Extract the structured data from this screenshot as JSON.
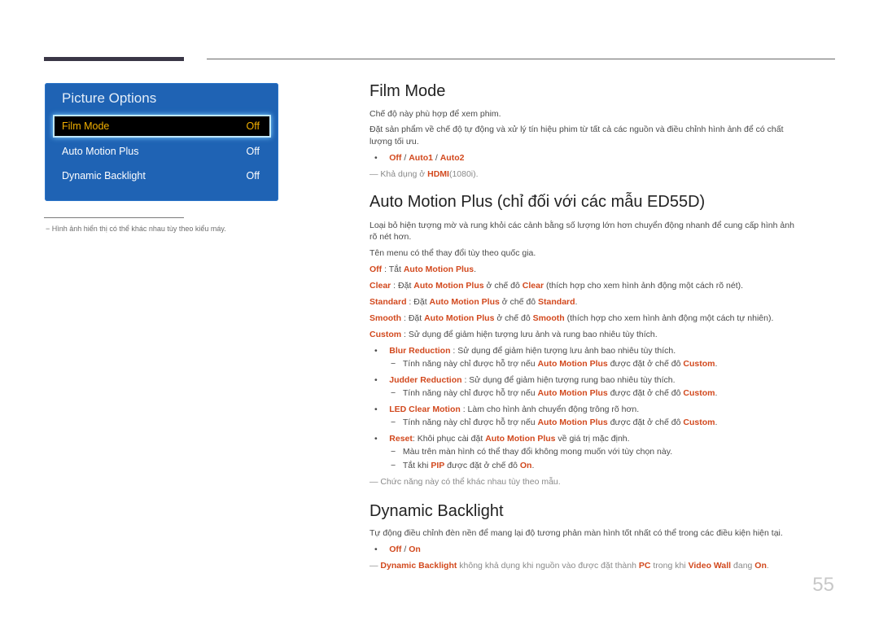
{
  "menu": {
    "title": "Picture Options",
    "items": [
      {
        "label": "Film Mode",
        "value": "Off",
        "selected": true
      },
      {
        "label": "Auto Motion Plus",
        "value": "Off"
      },
      {
        "label": "Dynamic Backlight",
        "value": "Off"
      }
    ],
    "note": "Hình ảnh hiển thị có thể khác nhau tùy theo kiểu máy."
  },
  "film_mode": {
    "title": "Film Mode",
    "p1": "Chế độ này phù hợp để xem phim.",
    "p2a": "Đặt sản phẩm về chế độ tự động và xử lý tín hiệu phim từ tất cả các nguồn và điều chỉnh hình ảnh để có chất",
    "p2b": "lượng tối ưu.",
    "opt_off": "Off",
    "opt_auto1": "Auto1",
    "opt_auto2": "Auto2",
    "sep": " / ",
    "note_pre": "Khả dụng ở ",
    "note_hl": "HDMI",
    "note_post": "(1080i)."
  },
  "amp": {
    "title": "Auto Motion Plus (chỉ đối với các mẫu ED55D)",
    "p1a": "Loại bỏ hiện tượng mờ và rung khỏi các cảnh bằng số lượng lớn hơn chuyển động nhanh để cung cấp hình ảnh",
    "p1b": "rõ nét hơn.",
    "p2": "Tên menu có thể thay đổi tùy theo quốc gia.",
    "amp": "Auto Motion Plus",
    "off": "Off",
    "off_text": " : Tắt ",
    "clear": "Clear",
    "set_text": " : Đặt ",
    "mode_text": " ở chế đô ",
    "clear_tail": " (thích hợp cho xem hình ảnh động một cách rõ nét).",
    "standard": "Standard",
    "smooth": "Smooth",
    "smooth_tail": " (thích hợp cho xem hình ảnh động một cách tự nhiên).",
    "custom": "Custom",
    "custom_text": " : Sử dụng để giảm hiện tượng lưu ảnh và rung bao nhiêu tùy thích.",
    "blur": "Blur Reduction",
    "blur_text": " : Sử dụng để giảm hiện tượng lưu ảnh bao nhiêu tùy thích.",
    "supported_pre": "Tính năng này chỉ được hỗ trợ nếu ",
    "supported_mid": " được đặt ở chế đô ",
    "judder": "Judder Reduction",
    "judder_text": " : Sử dụng để giảm hiện tượng rung bao nhiêu tùy thích.",
    "led": "LED Clear Motion",
    "led_text": " : Làm cho hình ảnh chuyển động trông rõ hơn.",
    "reset": "Reset",
    "reset_pre": ": Khôi phục cài đặt ",
    "reset_post": " về giá trị mặc định.",
    "reset_note1": "Màu trên màn hình có thể thay đổi không mong muốn với tùy chọn này.",
    "reset_note2_pre": "Tắt khi ",
    "pip": "PIP",
    "on": "On",
    "note": "Chức năng này có thể khác nhau tùy theo mẫu."
  },
  "db": {
    "title": "Dynamic Backlight",
    "p1": "Tự động điều chỉnh đèn nền để mang lại độ tương phản màn hình tốt nhất có thể trong các điều kiện hiện tại.",
    "off": "Off",
    "on": "On",
    "note_hl": "Dynamic Backlight",
    "note_mid1": " không khả dụng khi nguồn vào được đặt thành ",
    "pc": "PC",
    "note_mid2": " trong khi ",
    "vw": "Video Wall",
    "note_mid3": " đang ",
    "note_end": "."
  },
  "page_number": "55"
}
